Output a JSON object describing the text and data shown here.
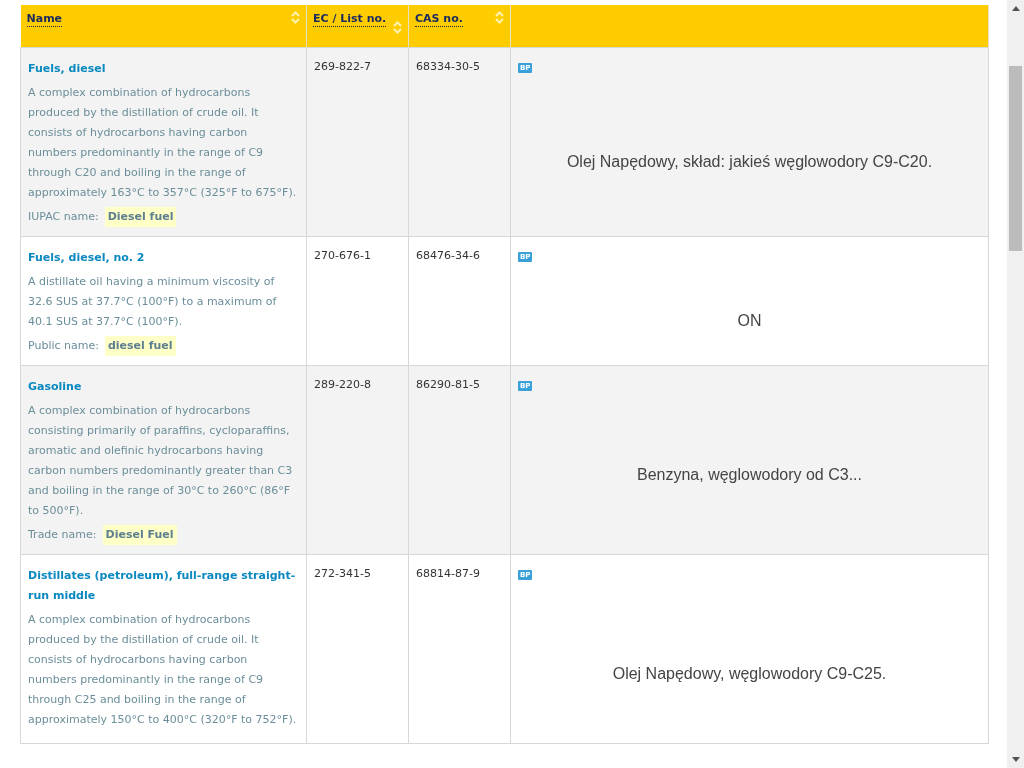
{
  "table": {
    "columns": [
      {
        "label": "Name"
      },
      {
        "label": "EC / List no."
      },
      {
        "label": "CAS no."
      }
    ],
    "rows": [
      {
        "name": "Fuels, diesel",
        "description": "A complex combination of hydrocarbons produced by the distillation of crude oil. It consists of hydrocarbons having carbon numbers predominantly in the range of C9 through C20 and boiling in the range of approximately 163°C to 357°C (325°F to 675°F).",
        "alt_name_label": "IUPAC name:",
        "alt_name": "Diesel fuel",
        "ec": "269-822-7",
        "cas": "68334-30-5",
        "badge": "BP",
        "note": "Olej Napędowy, skład: jakieś węglowodory C9-C20."
      },
      {
        "name": "Fuels, diesel, no. 2",
        "description": "A distillate oil having a minimum viscosity of 32.6 SUS at 37.7°C (100°F) to a maximum of 40.1 SUS at 37.7°C (100°F).",
        "alt_name_label": "Public name:",
        "alt_name": "diesel fuel",
        "ec": "270-676-1",
        "cas": "68476-34-6",
        "badge": "BP",
        "note": "ON"
      },
      {
        "name": "Gasoline",
        "description": "A complex combination of hydrocarbons consisting primarily of paraffins, cycloparaffins, aromatic and olefinic hydrocarbons having carbon numbers predominantly greater than C3 and boiling in the range of 30°C to 260°C (86°F to 500°F).",
        "alt_name_label": "Trade name:",
        "alt_name": "Diesel Fuel",
        "ec": "289-220-8",
        "cas": "86290-81-5",
        "badge": "BP",
        "note": "Benzyna, węglowodory od C3..."
      },
      {
        "name": "Distillates (petroleum), full-range straight-run middle",
        "description": "A complex combination of hydrocarbons produced by the distillation of crude oil. It consists of hydrocarbons having carbon numbers predominantly in the range of C9 through C25 and boiling in the range of approximately 150°C to 400°C (320°F to 752°F).",
        "ec": "272-341-5",
        "cas": "68814-87-9",
        "badge": "BP",
        "note": "Olej Napędowy, węglowodory C9-C25."
      }
    ]
  }
}
